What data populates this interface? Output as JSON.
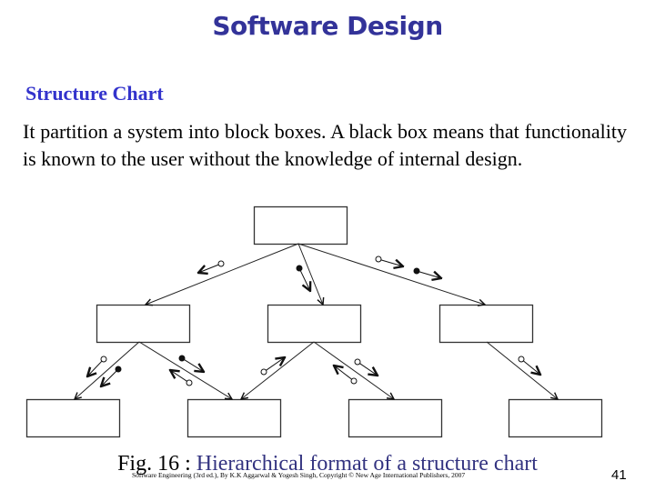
{
  "slide": {
    "title": "Software Design",
    "heading": "Structure Chart",
    "body": "It partition a system into block boxes. A black box means that functionality is known to the user without the knowledge of internal design.",
    "caption_prefix": "Fig. 16 : ",
    "caption_title": "Hierarchical format of a structure chart",
    "footer_note": "Software Engineering (3rd ed.), By K.K Aggarwal & Yogesh Singh, Copyright © New Age International Publishers, 2007",
    "page_number": "41",
    "colors": {
      "title": "#333399",
      "heading": "#3333cc",
      "caption_title": "#333380",
      "lines": "#222222"
    }
  },
  "diagram": {
    "modules": [
      {
        "id": "top",
        "level": 0
      },
      {
        "id": "mid-left",
        "level": 1
      },
      {
        "id": "mid-center",
        "level": 1
      },
      {
        "id": "mid-right",
        "level": 1
      },
      {
        "id": "bottom-1",
        "level": 2
      },
      {
        "id": "bottom-2",
        "level": 2
      },
      {
        "id": "bottom-3",
        "level": 2
      },
      {
        "id": "bottom-4",
        "level": 2
      }
    ],
    "calls": [
      {
        "from": "top",
        "to": "mid-left",
        "couples": [
          "data-up"
        ]
      },
      {
        "from": "top",
        "to": "mid-center",
        "couples": [
          "control-down"
        ]
      },
      {
        "from": "top",
        "to": "mid-right",
        "couples": [
          "data-down",
          "control-down"
        ]
      },
      {
        "from": "mid-left",
        "to": "bottom-1",
        "couples": [
          "data-down",
          "control-down"
        ]
      },
      {
        "from": "mid-left",
        "to": "bottom-2",
        "couples": [
          "control-down",
          "data-up"
        ]
      },
      {
        "from": "mid-center",
        "to": "bottom-2",
        "couples": [
          "data-up"
        ]
      },
      {
        "from": "mid-center",
        "to": "bottom-3",
        "couples": [
          "data-down",
          "data-up"
        ]
      },
      {
        "from": "mid-right",
        "to": "bottom-4",
        "couples": [
          "data-down"
        ]
      }
    ]
  }
}
